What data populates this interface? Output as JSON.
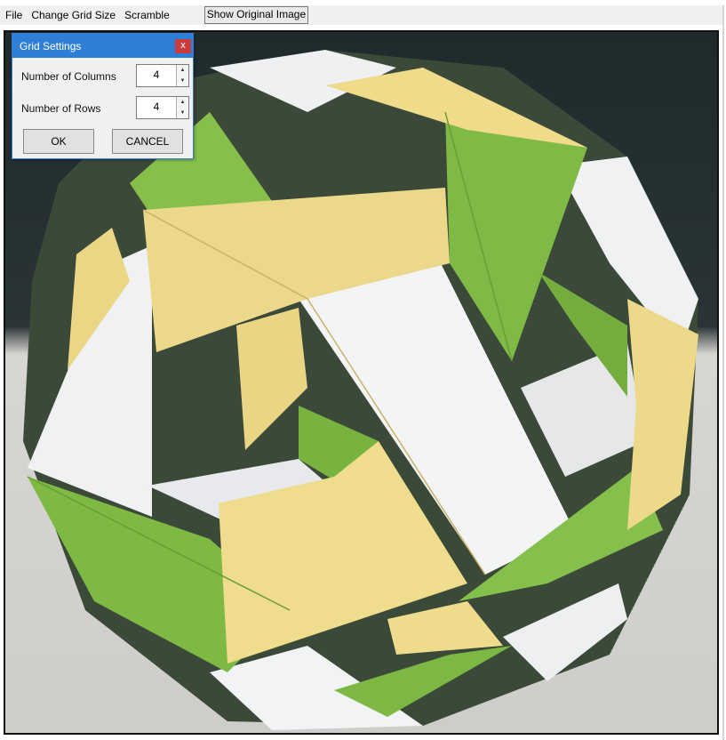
{
  "menubar": {
    "items": [
      "File",
      "Change Grid Size",
      "Scramble"
    ],
    "show_original_label": "Show Original Image"
  },
  "image": {
    "description_icon": "origami-photo"
  },
  "dialog": {
    "title": "Grid Settings",
    "close_label": "x",
    "columns_label": "Number of Columns",
    "columns_value": "4",
    "rows_label": "Number of Rows",
    "rows_value": "4",
    "ok_label": "OK",
    "cancel_label": "CANCEL",
    "spin_up": "▲",
    "spin_down": "▼"
  },
  "colors": {
    "title_bar": "#2f7fd6",
    "close_button": "#c83c3c",
    "paper_green": "#88c04c",
    "paper_yellow": "#efdb8c",
    "paper_white": "#f2f2f4"
  }
}
